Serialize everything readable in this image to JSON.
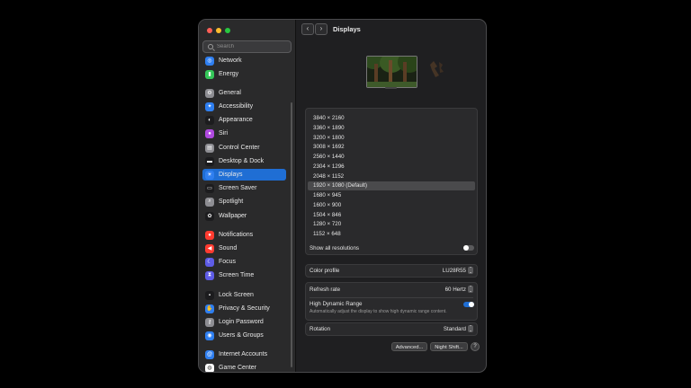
{
  "window": {
    "title": "Displays"
  },
  "sidebar": {
    "search_placeholder": "Search",
    "items": [
      {
        "label": "Network",
        "icon": "globe-icon",
        "color": "#2f7ff0"
      },
      {
        "label": "Energy",
        "icon": "battery-icon",
        "color": "#35c759"
      },
      {
        "label": "General",
        "icon": "gear-icon",
        "color": "#8e8e93"
      },
      {
        "label": "Accessibility",
        "icon": "accessibility-icon",
        "color": "#2f7ff0"
      },
      {
        "label": "Appearance",
        "icon": "appearance-icon",
        "color": "#1c1c1e"
      },
      {
        "label": "Siri",
        "icon": "siri-icon",
        "color": "#b04adf"
      },
      {
        "label": "Control Center",
        "icon": "control-center-icon",
        "color": "#8e8e93"
      },
      {
        "label": "Desktop & Dock",
        "icon": "dock-icon",
        "color": "#1c1c1e"
      },
      {
        "label": "Displays",
        "icon": "sun-icon",
        "color": "#2f7ff0"
      },
      {
        "label": "Screen Saver",
        "icon": "screensaver-icon",
        "color": "#1c1c1e"
      },
      {
        "label": "Spotlight",
        "icon": "magnifier-icon",
        "color": "#8e8e93"
      },
      {
        "label": "Wallpaper",
        "icon": "flower-icon",
        "color": "#1c1c1e"
      },
      {
        "label": "Notifications",
        "icon": "bell-icon",
        "color": "#ff3b30"
      },
      {
        "label": "Sound",
        "icon": "speaker-icon",
        "color": "#ff3b30"
      },
      {
        "label": "Focus",
        "icon": "moon-icon",
        "color": "#5e5ce6"
      },
      {
        "label": "Screen Time",
        "icon": "hourglass-icon",
        "color": "#5e5ce6"
      },
      {
        "label": "Lock Screen",
        "icon": "lock-icon",
        "color": "#1c1c1e"
      },
      {
        "label": "Privacy & Security",
        "icon": "hand-icon",
        "color": "#2f7ff0"
      },
      {
        "label": "Login Password",
        "icon": "key-icon",
        "color": "#8e8e93"
      },
      {
        "label": "Users & Groups",
        "icon": "users-icon",
        "color": "#2f7ff0"
      },
      {
        "label": "Internet Accounts",
        "icon": "at-icon",
        "color": "#2f7ff0"
      },
      {
        "label": "Game Center",
        "icon": "game-center-icon",
        "color": "#ffffff"
      }
    ]
  },
  "resolutions": [
    "3840 × 2160",
    "3360 × 1890",
    "3200 × 1800",
    "3008 × 1692",
    "2560 × 1440",
    "2304 × 1296",
    "2048 × 1152",
    "1920 × 1080 (Default)",
    "1680 × 945",
    "1600 × 900",
    "1504 × 846",
    "1280 × 720",
    "1152 × 648"
  ],
  "selected_resolution": "1920 × 1080 (Default)",
  "show_all_resolutions": {
    "label": "Show all resolutions",
    "enabled": false
  },
  "color_profile": {
    "label": "Color profile",
    "value": "LU28R55"
  },
  "refresh_rate": {
    "label": "Refresh rate",
    "value": "60 Hertz"
  },
  "hdr": {
    "label": "High Dynamic Range",
    "description": "Automatically adjust the display to show high dynamic range content.",
    "enabled": true
  },
  "rotation": {
    "label": "Rotation",
    "value": "Standard"
  },
  "buttons": {
    "advanced": "Advanced...",
    "night_shift": "Night Shift...",
    "help": "?"
  },
  "colors": {
    "accent": "#1f6ed4",
    "window_bg": "#1f1f21",
    "sidebar_bg": "#2a2a2b"
  }
}
